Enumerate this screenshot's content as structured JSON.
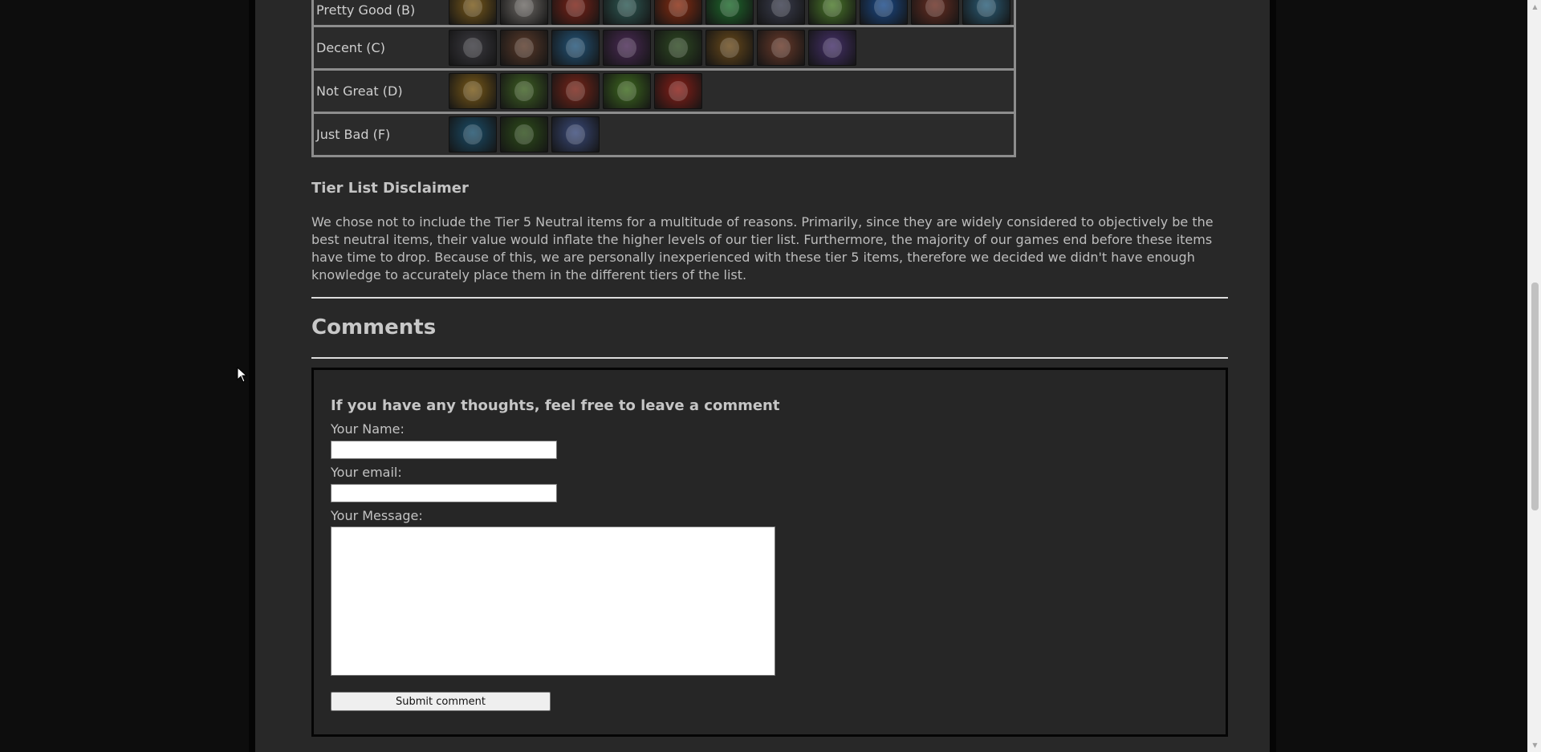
{
  "tiers": [
    {
      "label": "Pretty Good (B)",
      "items": [
        {
          "name": "item-icon-gold-claw",
          "color": "#7a5a1a"
        },
        {
          "name": "item-icon-stone-orb",
          "color": "#6e6a66"
        },
        {
          "name": "item-icon-red-apple",
          "color": "#7d2216"
        },
        {
          "name": "item-icon-green-blades",
          "color": "#2e5a55"
        },
        {
          "name": "item-icon-fire-orb",
          "color": "#8a2c10"
        },
        {
          "name": "item-icon-green-pendant",
          "color": "#1e6b2c"
        },
        {
          "name": "item-icon-dark-helm",
          "color": "#3a3d4e"
        },
        {
          "name": "item-icon-jade-spear",
          "color": "#4b7a2a"
        },
        {
          "name": "item-icon-blue-wave",
          "color": "#1a4a8a"
        },
        {
          "name": "item-icon-red-horn",
          "color": "#6a2e22"
        },
        {
          "name": "item-icon-ice-crystal",
          "color": "#2b5f7a"
        }
      ]
    },
    {
      "label": "Decent (C)",
      "items": [
        {
          "name": "item-icon-battle-axe",
          "color": "#3b3a40"
        },
        {
          "name": "item-icon-ruby-amulet",
          "color": "#5a3a2a"
        },
        {
          "name": "item-icon-frost-shard",
          "color": "#23557a"
        },
        {
          "name": "item-icon-pink-wand",
          "color": "#4a2a55"
        },
        {
          "name": "item-icon-green-bow",
          "color": "#2e4a22"
        },
        {
          "name": "item-icon-golden-crown",
          "color": "#6a4a1a"
        },
        {
          "name": "item-icon-red-chest",
          "color": "#6a3a2a"
        },
        {
          "name": "item-icon-violet-blade",
          "color": "#45306a"
        }
      ]
    },
    {
      "label": "Not Great (D)",
      "items": [
        {
          "name": "item-icon-gold-beast",
          "color": "#7a5a18"
        },
        {
          "name": "item-icon-orange-fruit",
          "color": "#3e6022"
        },
        {
          "name": "item-icon-crimson-wing",
          "color": "#7a2418"
        },
        {
          "name": "item-icon-green-spirit",
          "color": "#3e6a1e"
        },
        {
          "name": "item-icon-red-heart",
          "color": "#8a1e16"
        }
      ]
    },
    {
      "label": "Just Bad (F)",
      "items": [
        {
          "name": "item-icon-blue-orb",
          "color": "#1a4e6a"
        },
        {
          "name": "item-icon-green-cloak",
          "color": "#2e4e1a"
        },
        {
          "name": "item-icon-arcane-staff",
          "color": "#3a4a7a"
        }
      ]
    }
  ],
  "disclaimer": {
    "title": "Tier List Disclaimer",
    "text": "We chose not to include the Tier 5 Neutral items for a multitude of reasons. Primarily, since they are widely considered to objectively be the best neutral items, their value would inflate the higher levels of our tier list. Furthermore, the majority of our games end before these items have time to drop. Because of this, we are personally inexperienced with these tier 5 items, therefore we decided we didn't have enough knowledge to accurately place them in the different tiers of the list."
  },
  "comments": {
    "title": "Comments",
    "form_heading": "If you have any thoughts, feel free to leave a comment",
    "name_label": "Your Name:",
    "name_value": "",
    "email_label": "Your email:",
    "email_value": "",
    "message_label": "Your Message:",
    "message_value": "",
    "submit_label": "Submit comment"
  },
  "scrollbar": {
    "up_arrow": "▲",
    "down_arrow": "▼"
  }
}
